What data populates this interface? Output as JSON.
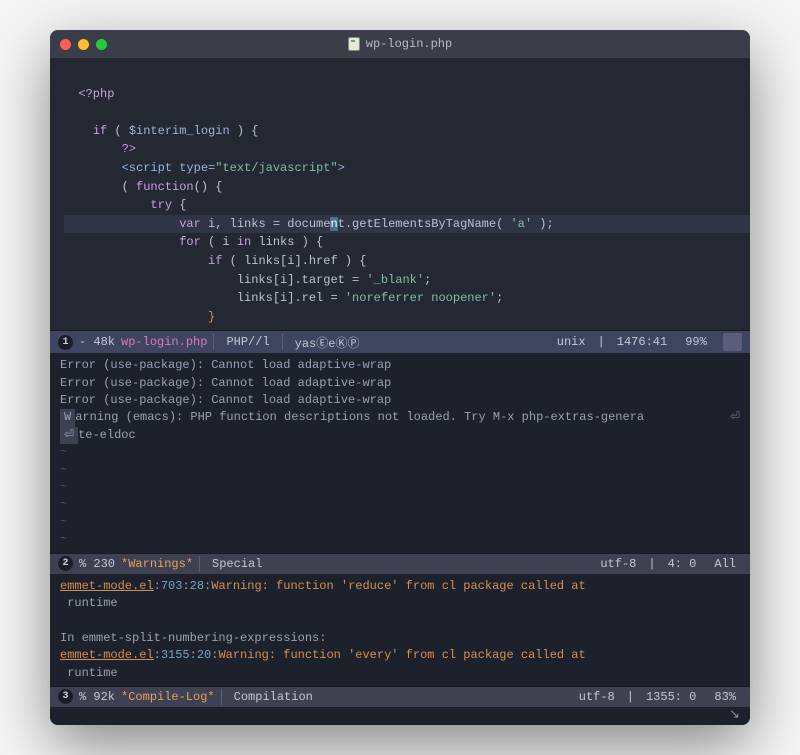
{
  "titlebar": {
    "filename": "wp-login.php"
  },
  "code": {
    "l1_open": "<?php",
    "l3_if": "if",
    "l3_var": "$interim_login",
    "l3_rest": " ) {",
    "l4": "?>",
    "l5_open": "<script",
    "l5_attr": " type=",
    "l5_val": "\"text/javascript\"",
    "l5_close": ">",
    "l6_p1": "( ",
    "l6_fn": "function",
    "l6_p2": "() {",
    "l7_try": "try",
    "l7_brace": " {",
    "l8_var": "var",
    "l8_mid1": " i, links = docume",
    "l8_cursor": "n",
    "l8_mid2": "t.getElementsByTagName( ",
    "l8_str": "'a'",
    "l8_end": " );",
    "l9_for": "for",
    "l9_mid1": " ( i ",
    "l9_in": "in",
    "l9_mid2": " links ) {",
    "l10_if": "if",
    "l10_mid": " ( links[i].href ) {",
    "l11_a": "links[i].target = ",
    "l11_s": "'_blank'",
    "l11_e": ";",
    "l12_a": "links[i].rel = ",
    "l12_s": "'noreferrer noopener'",
    "l12_e": ";",
    "l13": "}"
  },
  "modeline1": {
    "badge": "1",
    "left": " - 48k ",
    "file": "wp-login.php",
    "mode": "PHP//l",
    "minor": "yasⒺeⓀⓅ",
    "enc": "unix",
    "pos": "1476:41",
    "pct": "99%"
  },
  "messages": {
    "lines": [
      "Error (use-package): Cannot load adaptive-wrap",
      "Error (use-package): Cannot load adaptive-wrap",
      "Error (use-package): Cannot load adaptive-wrap"
    ],
    "warn_pre": "W",
    "warn_rest": "arning (emacs): PHP function descriptions not loaded. Try M-x php-extras-genera",
    "warn_cont": "te-eldoc"
  },
  "modeline2": {
    "badge": "2",
    "left": " % 230 ",
    "buf": "*Warnings*",
    "mode": "Special",
    "enc": "utf-8",
    "pos": "4: 0",
    "pct": "All"
  },
  "compile": {
    "l1_file": "emmet-mode.el",
    "l1_ln": "703",
    "l1_col": "28",
    "l1_msg": "Warning: function 'reduce' from cl package called at",
    "l2": " runtime",
    "l4": "In emmet-split-numbering-expressions:",
    "l5_file": "emmet-mode.el",
    "l5_ln": "3155",
    "l5_col": "20",
    "l5_msg": "Warning: function 'every' from cl package called at",
    "l6": " runtime"
  },
  "modeline3": {
    "badge": "3",
    "left": " % 92k ",
    "buf": "*Compile-Log*",
    "mode": "Compilation",
    "enc": "utf-8",
    "pos": "1355: 0",
    "pct": "83%"
  },
  "echo": {
    "glyph": "↘"
  }
}
